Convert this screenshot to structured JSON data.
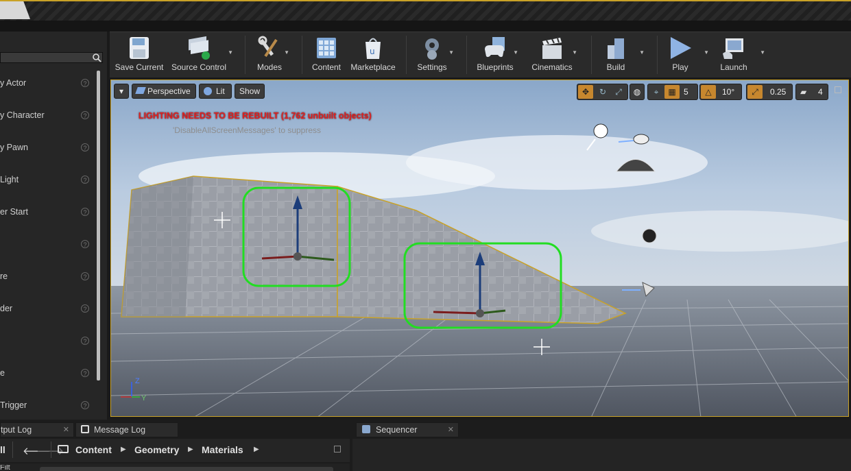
{
  "toolbar": {
    "items": [
      {
        "label": "Save Current",
        "icon": "floppy-disk-icon"
      },
      {
        "label": "Source Control",
        "icon": "source-control-icon"
      },
      {
        "label": "Modes",
        "icon": "modes-tools-icon"
      },
      {
        "label": "Content",
        "icon": "content-grid-icon"
      },
      {
        "label": "Marketplace",
        "icon": "marketplace-bag-icon"
      },
      {
        "label": "Settings",
        "icon": "settings-gear-icon"
      },
      {
        "label": "Blueprints",
        "icon": "blueprints-gamepad-icon"
      },
      {
        "label": "Cinematics",
        "icon": "clapperboard-icon"
      },
      {
        "label": "Build",
        "icon": "build-blocks-icon"
      },
      {
        "label": "Play",
        "icon": "play-triangle-icon"
      },
      {
        "label": "Launch",
        "icon": "launch-monitor-icon"
      }
    ]
  },
  "place_panel": {
    "items": [
      {
        "label": "y Actor"
      },
      {
        "label": "y Character"
      },
      {
        "label": "y Pawn"
      },
      {
        "label": "Light"
      },
      {
        "label": "er Start"
      },
      {
        "label": ""
      },
      {
        "label": "re"
      },
      {
        "label": "der"
      },
      {
        "label": ""
      },
      {
        "label": "e"
      },
      {
        "label": "Trigger"
      }
    ],
    "help_glyph": "?"
  },
  "viewport": {
    "view_mode": "Perspective",
    "lighting": "Lit",
    "show_label": "Show",
    "warning": "LIGHTING NEEDS TO BE REBUILT (1,762 unbuilt objects)",
    "suppress_hint": "'DisableAllScreenMessages' to suppress",
    "grid_snap": "5",
    "rotation_snap": "10°",
    "scale_snap": "0.25",
    "camera_speed": "4",
    "axis_z": "Z",
    "axis_y": "Y"
  },
  "colors": {
    "selection_outline": "#c9a227",
    "highlight_box": "#22dd22",
    "warning_text": "#e02020",
    "active_toggle": "#c7872e"
  },
  "bottom": {
    "tabs": [
      {
        "label": "tput Log"
      },
      {
        "label": "Message Log"
      },
      {
        "label": "Sequencer"
      }
    ],
    "filter_label": "ll",
    "breadcrumb": [
      "Content",
      "Geometry",
      "Materials"
    ],
    "filters_label": "Filt"
  }
}
